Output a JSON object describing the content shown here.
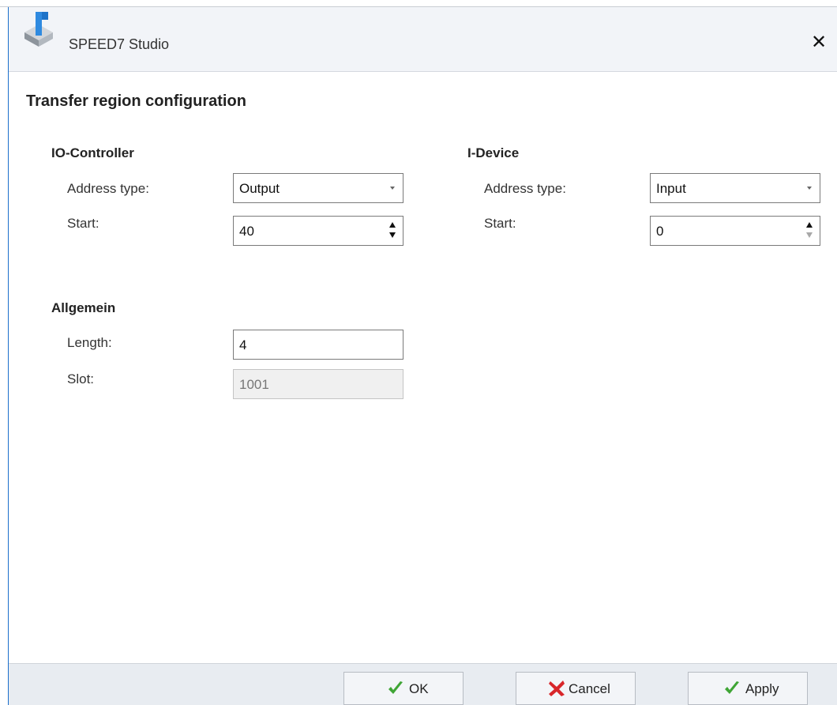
{
  "window": {
    "title": "SPEED7 Studio",
    "close_glyph": "✕",
    "icon": "speed7-app-icon"
  },
  "page_title": "Transfer region configuration",
  "io_controller": {
    "heading": "IO-Controller",
    "address_type_label": "Address type:",
    "address_type_value": "Output",
    "start_label": "Start:",
    "start_value": "40"
  },
  "i_device": {
    "heading": "I-Device",
    "address_type_label": "Address type:",
    "address_type_value": "Input",
    "start_label": "Start:",
    "start_value": "0"
  },
  "general": {
    "heading": "Allgemein",
    "length_label": "Length:",
    "length_value": "4",
    "slot_label": "Slot:",
    "slot_value": "1001"
  },
  "footer": {
    "ok_label": "OK",
    "cancel_label": "Cancel",
    "apply_label": "Apply",
    "ok_icon": "check-icon",
    "cancel_icon": "x-icon",
    "apply_icon": "check-icon"
  },
  "colors": {
    "window_border": "#1b6fcb",
    "check_green": "#3fa535",
    "cancel_red": "#d8262a"
  }
}
